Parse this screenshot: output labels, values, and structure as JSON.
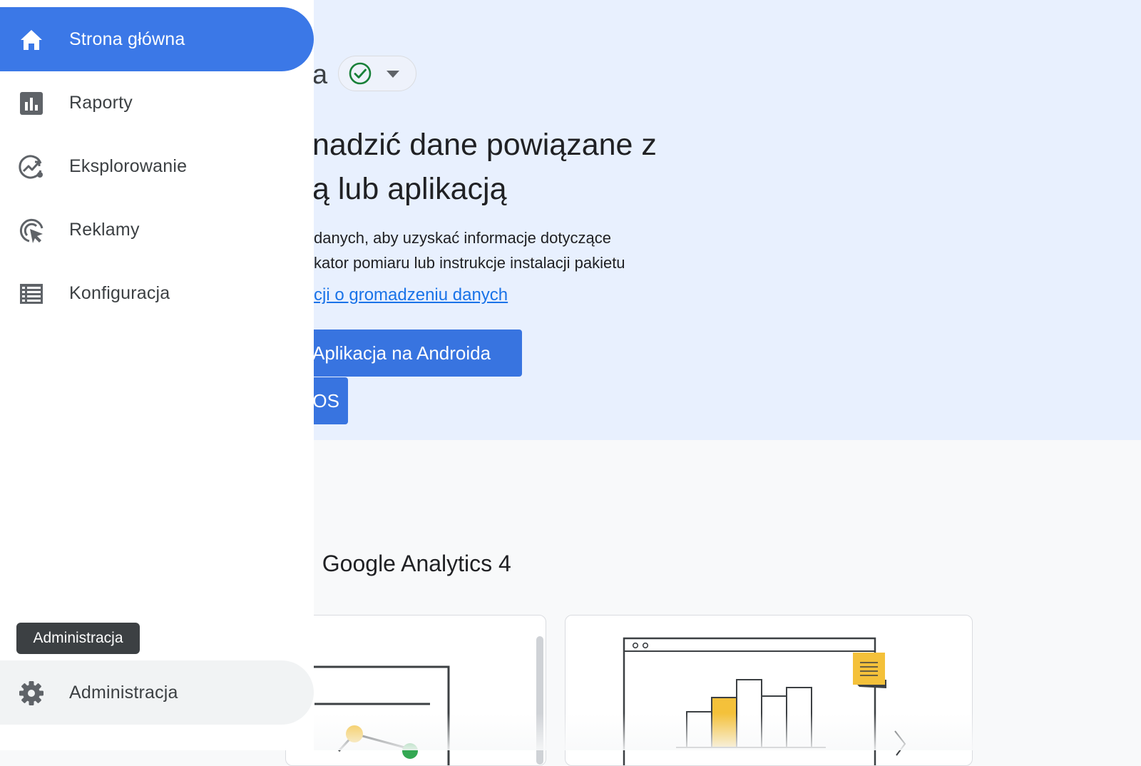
{
  "sidebar": {
    "items": [
      {
        "label": "Strona główna",
        "icon": "home-icon",
        "active": true
      },
      {
        "label": "Raporty",
        "icon": "bar-chart-icon"
      },
      {
        "label": "Eksplorowanie",
        "icon": "explore-trend-icon"
      },
      {
        "label": "Reklamy",
        "icon": "ads-cursor-icon"
      },
      {
        "label": "Konfiguracja",
        "icon": "list-icon"
      }
    ],
    "admin": {
      "label": "Administracja",
      "icon": "gear-icon"
    },
    "tooltip": "Administracja"
  },
  "main": {
    "title_fragment": "a",
    "status_icon": "check-circle-icon",
    "headline_line1": "nadzić dane powiązane z",
    "headline_line2": "ą lub aplikacją",
    "desc_line1": "danych, aby uzyskać informacje dotyczące",
    "desc_line2": "kator pomiaru lub instrukcje instalacji pakietu",
    "learn_link": "cji o gromadzeniu danych",
    "android_button": "Aplikacja na Androida",
    "ios_button": "OS",
    "section_title": ": Google Analytics 4"
  },
  "colors": {
    "accent": "#3b78e7",
    "hero_bg": "#e8f0fe",
    "link": "#1a73e8",
    "check": "#188038",
    "illustration_yellow": "#f4c13a"
  }
}
